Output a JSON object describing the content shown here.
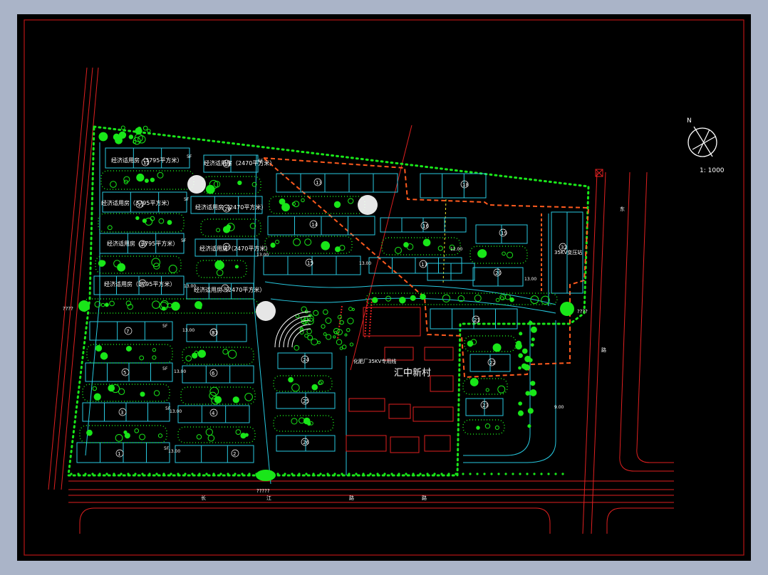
{
  "plan": {
    "scale_label": "1: 1000",
    "north_label": "N",
    "project_name": "汇中新村",
    "substation_label": "35KV变压站",
    "power_line_label": "化肥厂35KV专用线",
    "road_chars": [
      "长",
      "江",
      "路",
      "路"
    ],
    "east_road_chars": [
      "东",
      "路"
    ],
    "gate_left": "????",
    "gate_bottom": "?????",
    "gate_right": "????"
  },
  "housing_labels": [
    "经济适用房（3795平方米）",
    "经济适用房（2470平方米）",
    "经济适用房（3795平方米）",
    "经济适用房（2470平方米）",
    "经济适用房（3795平方米）",
    "经济适用房（2470平方米）",
    "经济适用房（3795平方米）",
    "经济适用房（2470平方米）"
  ],
  "building_numbers": [
    "1",
    "2",
    "3",
    "4",
    "5",
    "6",
    "7",
    "8",
    "9",
    "10",
    "11",
    "12",
    "13",
    "14",
    "15",
    "16",
    "17",
    "18",
    "19",
    "20",
    "21",
    "22",
    "23",
    "24",
    "25",
    "26",
    "27",
    "28",
    "29",
    "30",
    "31",
    "32"
  ],
  "floor_tags": [
    "5F",
    "6F",
    "5F",
    "5F",
    "5F",
    "5F",
    "5F",
    "5F"
  ],
  "elevations": [
    "13.00",
    "13.00",
    "13.00",
    "13.00",
    "13.00",
    "13.00",
    "13.00",
    "13.00",
    "12.00",
    "9.00"
  ],
  "colors": {
    "background": "#000000",
    "frame": "#b81414",
    "vegetation": "#19e619",
    "building": "#27c9e0",
    "boundary_red": "#e02020",
    "dashed_orange": "#ff5a1e",
    "annotation": "#ffffff",
    "yellow": "#f0e62a"
  }
}
